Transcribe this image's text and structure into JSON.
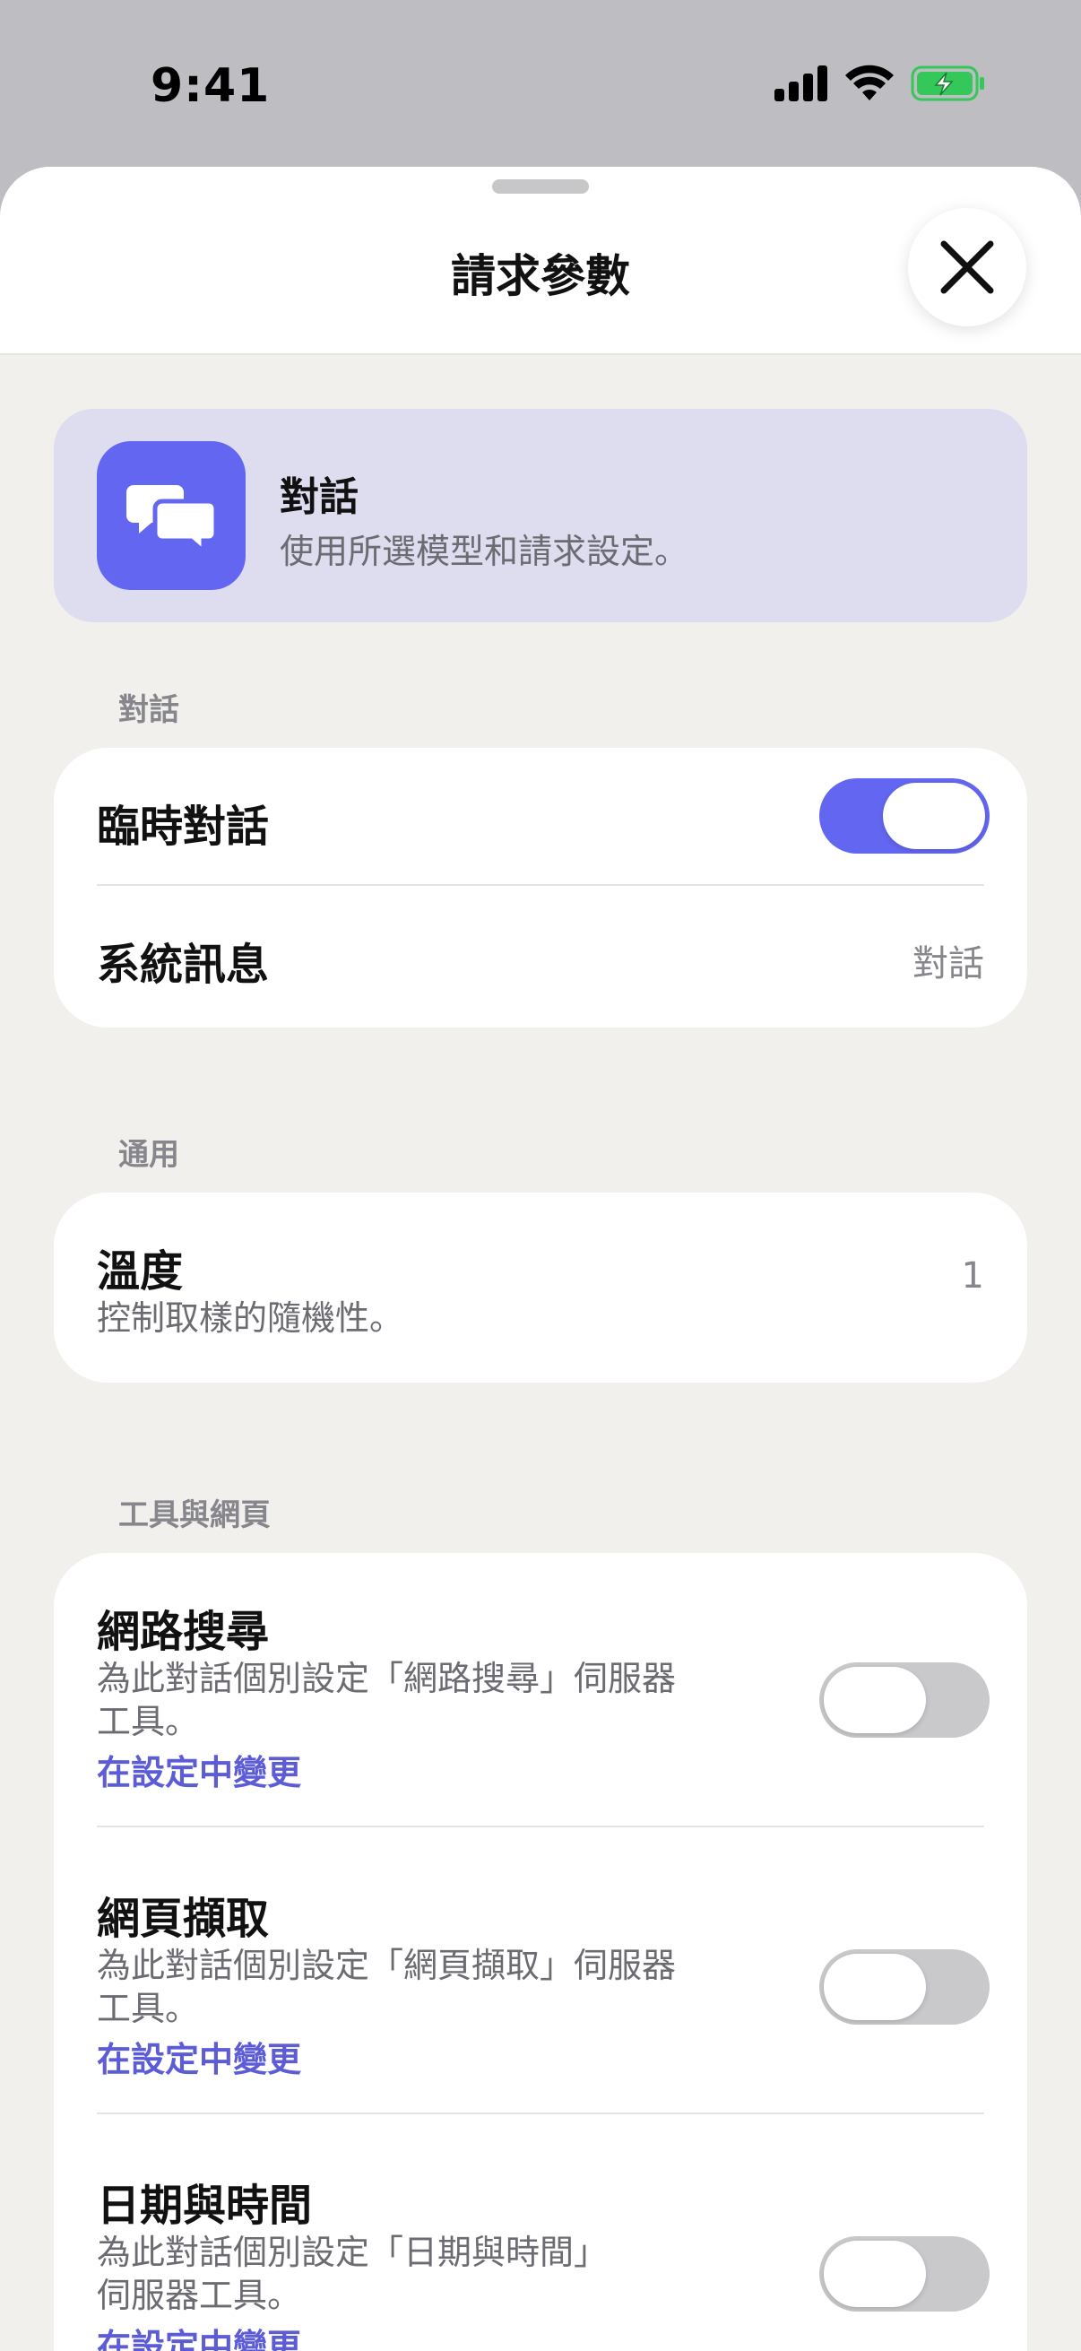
{
  "status_bar": {
    "time": "9:41"
  },
  "sheet": {
    "title": "請求參數"
  },
  "hero": {
    "title": "對話",
    "subtitle": "使用所選模型和請求設定。",
    "icon": "chat-bubbles-icon"
  },
  "sections": {
    "conversation": {
      "label": "對話",
      "temporary_chat": {
        "label": "臨時對話",
        "enabled": true
      },
      "system_message": {
        "label": "系統訊息",
        "value": "對話"
      }
    },
    "general": {
      "label": "通用",
      "temperature": {
        "label": "溫度",
        "description": "控制取樣的隨機性。",
        "value": "1"
      }
    },
    "tools": {
      "label": "工具與網頁",
      "items": [
        {
          "title": "網路搜尋",
          "description_line1": "為此對話個別設定「網路搜尋」伺服器",
          "description_line2": "工具。",
          "link": "在設定中變更",
          "enabled": false
        },
        {
          "title": "網頁擷取",
          "description_line1": "為此對話個別設定「網頁擷取」伺服器",
          "description_line2": "工具。",
          "link": "在設定中變更",
          "enabled": false
        },
        {
          "title": "日期與時間",
          "description_line1": "為此對話個別設定「日期與時間」",
          "description_line2": "伺服器工具。",
          "link": "在設定中變更",
          "enabled": false
        }
      ]
    }
  },
  "colors": {
    "accent": "#6366f0",
    "link": "#5b5cd6",
    "toggle_off": "#c9c9cc",
    "battery": "#34c759"
  }
}
